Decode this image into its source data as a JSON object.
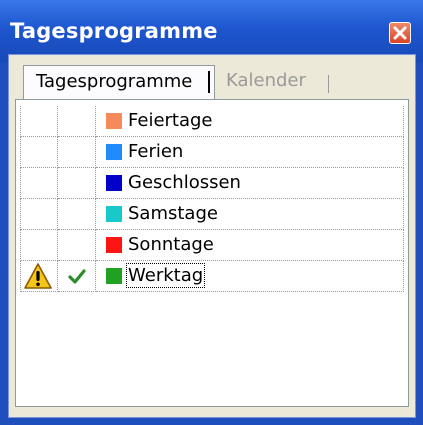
{
  "window": {
    "title": "Tagesprogramme"
  },
  "tabs": [
    {
      "label": "Tagesprogramme",
      "active": true
    },
    {
      "label": "Kalender",
      "active": false
    }
  ],
  "rows": [
    {
      "label": "Feiertage",
      "color": "#f78a5a",
      "warning": false,
      "checked": false
    },
    {
      "label": "Ferien",
      "color": "#1e8cff",
      "warning": false,
      "checked": false
    },
    {
      "label": "Geschlossen",
      "color": "#0000c8",
      "warning": false,
      "checked": false
    },
    {
      "label": "Samstage",
      "color": "#19c8c8",
      "warning": false,
      "checked": false
    },
    {
      "label": "Sonntage",
      "color": "#ff1414",
      "warning": false,
      "checked": false
    },
    {
      "label": "Werktag",
      "color": "#22a022",
      "warning": true,
      "checked": true
    }
  ],
  "icons": {
    "warning": "warning-icon",
    "check": "checkmark-icon",
    "close": "close-icon"
  }
}
